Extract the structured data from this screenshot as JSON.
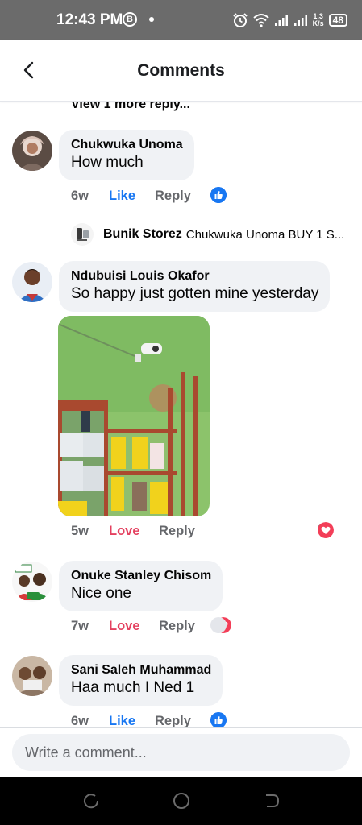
{
  "status_bar": {
    "time": "12:43 PM",
    "b_badge": "B",
    "net_speed_value": "1.3",
    "net_speed_unit": "K/s",
    "battery": "48",
    "icons": [
      "alarm-icon",
      "wifi-icon",
      "signal-icon",
      "signal-icon"
    ]
  },
  "header": {
    "title": "Comments",
    "back_icon": "back-arrow-icon"
  },
  "feed": {
    "view_more": "View 1 more reply...",
    "comments": [
      {
        "author": "Chukwuka Unoma",
        "text": "How much",
        "time": "6w",
        "reaction_action": "Like",
        "reply_action": "Reply",
        "reaction_count": "1",
        "reaction_types": [
          "like"
        ]
      },
      {
        "author": "Ndubuisi Louis Okafor",
        "text": "So happy just gotten mine yesterday",
        "has_photo": true,
        "time": "5w",
        "reaction_action": "Love",
        "reply_action": "Reply",
        "reaction_count": "1",
        "reaction_types": [
          "love"
        ]
      },
      {
        "author": "Onuke Stanley Chisom",
        "text": "Nice one",
        "time": "7w",
        "reaction_action": "Love",
        "reply_action": "Reply",
        "reaction_count": "2",
        "reaction_types": [
          "love",
          "other"
        ]
      },
      {
        "author": "Sani Saleh Muhammad",
        "text": "Haa much I Ned 1",
        "time": "6w",
        "reaction_action": "Like",
        "reply_action": "Reply",
        "reaction_count": "1",
        "reaction_types": [
          "like"
        ]
      }
    ],
    "reply_preview": {
      "author": "Bunik Storez",
      "text": "Chukwuka Unoma BUY 1 S..."
    }
  },
  "composer": {
    "placeholder": "Write a comment..."
  },
  "nav_bar": {
    "buttons": [
      "recent-apps-icon",
      "home-icon",
      "back-icon"
    ]
  },
  "colors": {
    "like_blue": "#1877f2",
    "love_red": "#e4405f",
    "bubble_bg": "#f0f2f5",
    "status_bar_bg": "#6b6b6b"
  }
}
